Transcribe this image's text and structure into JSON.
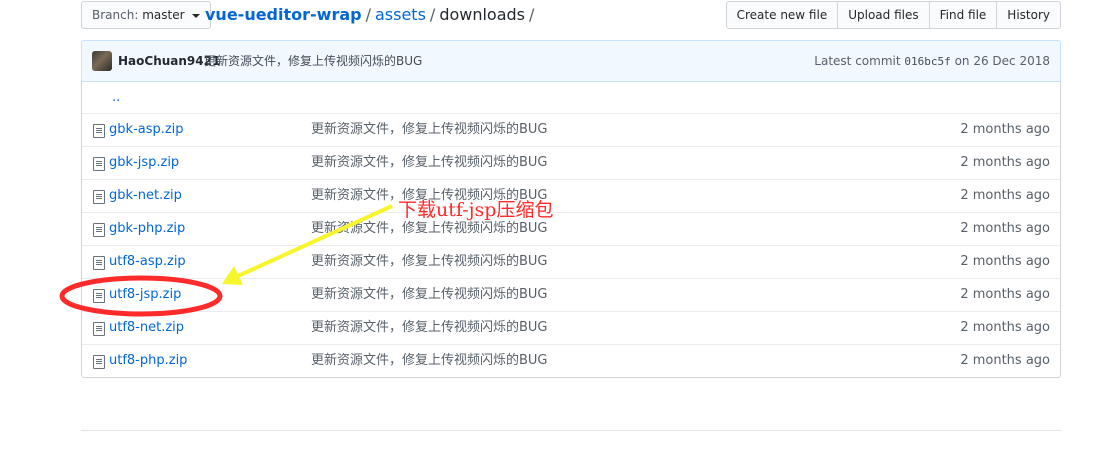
{
  "nav": {
    "branch_label": "Branch:",
    "branch_value": "master",
    "breadcrumb": {
      "repo": "vue-ueditor-wrap",
      "folder": "assets",
      "current": "downloads",
      "separator": "/"
    },
    "buttons": [
      "Create new file",
      "Upload files",
      "Find file",
      "History"
    ]
  },
  "commit": {
    "author": "HaoChuan9421",
    "message": "更新资源文件，修复上传视频闪烁的BUG",
    "latest_label": "Latest commit",
    "sha": "016bc5f",
    "date_text": "on 26 Dec 2018"
  },
  "files": {
    "parent_link": "..",
    "items": [
      {
        "name": "gbk-asp.zip",
        "message": "更新资源文件，修复上传视频闪烁的BUG",
        "age": "2 months ago"
      },
      {
        "name": "gbk-jsp.zip",
        "message": "更新资源文件，修复上传视频闪烁的BUG",
        "age": "2 months ago"
      },
      {
        "name": "gbk-net.zip",
        "message": "更新资源文件，修复上传视频闪烁的BUG",
        "age": "2 months ago"
      },
      {
        "name": "gbk-php.zip",
        "message": "更新资源文件，修复上传视频闪烁的BUG",
        "age": "2 months ago"
      },
      {
        "name": "utf8-asp.zip",
        "message": "更新资源文件，修复上传视频闪烁的BUG",
        "age": "2 months ago"
      },
      {
        "name": "utf8-jsp.zip",
        "message": "更新资源文件，修复上传视频闪烁的BUG",
        "age": "2 months ago"
      },
      {
        "name": "utf8-net.zip",
        "message": "更新资源文件，修复上传视频闪烁的BUG",
        "age": "2 months ago"
      },
      {
        "name": "utf8-php.zip",
        "message": "更新资源文件，修复上传视频闪烁的BUG",
        "age": "2 months ago"
      }
    ]
  },
  "annotation": {
    "text": "下载utf-jsp压缩包",
    "color": "#ff2a2a",
    "arrow_color": "#f7f52b",
    "highlighted_file": "utf8-jsp.zip"
  },
  "colors": {
    "link": "#0366d6",
    "commit_bar_bg": "#f1f8ff",
    "border": "#d1d5da"
  }
}
